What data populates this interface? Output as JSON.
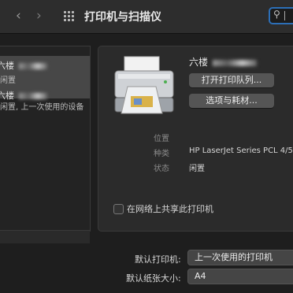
{
  "toolbar": {
    "back_icon": "‹",
    "forward_icon": "›",
    "title": "打印机与扫描仪",
    "search_icon": "⚲"
  },
  "printer_list": {
    "items": [
      {
        "name": "六楼",
        "status": "闲置"
      },
      {
        "name": "六楼",
        "status": "闲置, 上一次使用的设备"
      }
    ]
  },
  "detail": {
    "printer_name": "六楼",
    "open_queue_label": "打开打印队列...",
    "options_label": "选项与耗材...",
    "location_label": "位置",
    "location_value": "",
    "kind_label": "种类",
    "kind_value": "HP LaserJet Series PCL 4/5",
    "status_label": "状态",
    "status_value": "闲置",
    "share_label": "在网络上共享此打印机"
  },
  "defaults": {
    "default_printer_label": "默认打印机:",
    "default_printer_value": "上一次使用的打印机",
    "paper_size_label": "默认纸张大小:",
    "paper_size_value": "A4"
  }
}
